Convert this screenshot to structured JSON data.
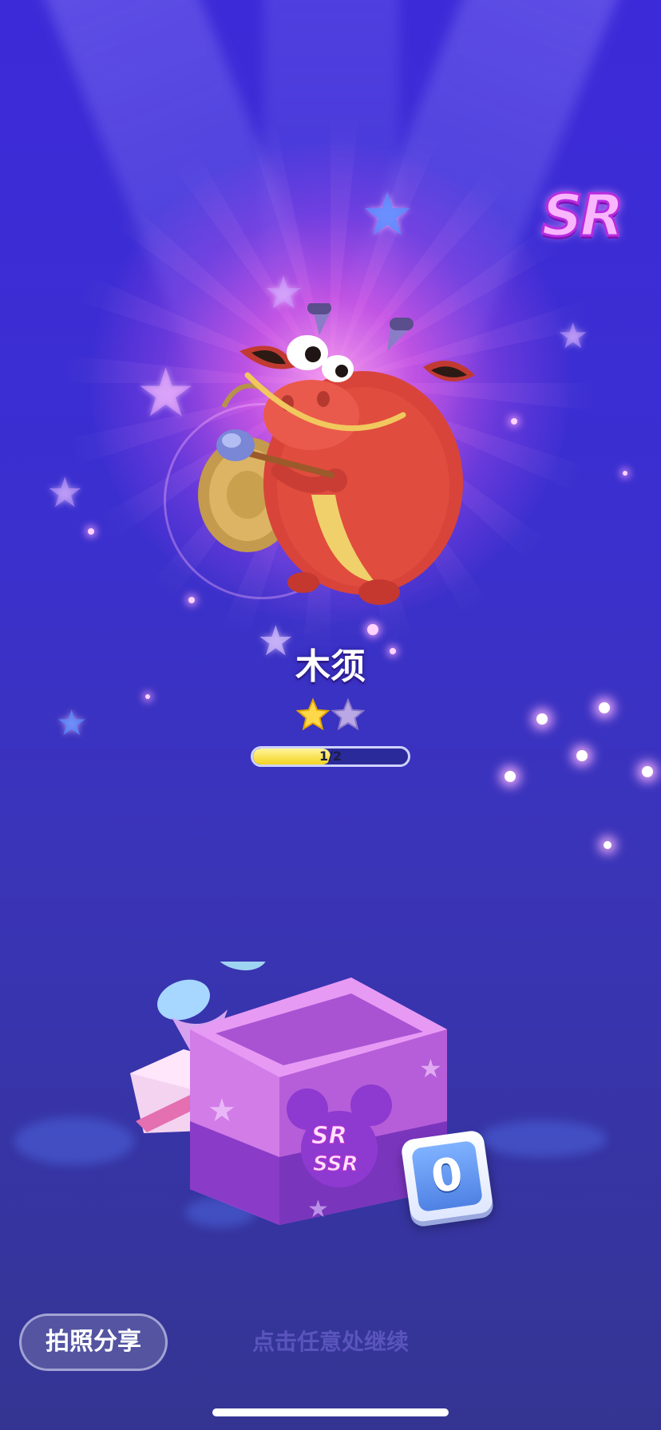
{
  "reward": {
    "rarity": "SR",
    "name": "木须",
    "stars_earned": 1,
    "stars_total": 2,
    "progress_current": 1,
    "progress_total": 2,
    "progress_label": "1/2"
  },
  "giftbox": {
    "labels": [
      "SR",
      "SSR"
    ],
    "remaining": "0"
  },
  "actions": {
    "share_label": "拍照分享",
    "hint": "点击任意处继续"
  },
  "colors": {
    "accent_pink": "#f9b6ff",
    "progress_fill": "#f3d321",
    "star_gold": "#ffd84a",
    "star_empty": "#b9a7e6"
  },
  "icons": {
    "rarity": "sr-badge-icon",
    "star": "star-icon",
    "gift": "gift-box-icon"
  }
}
